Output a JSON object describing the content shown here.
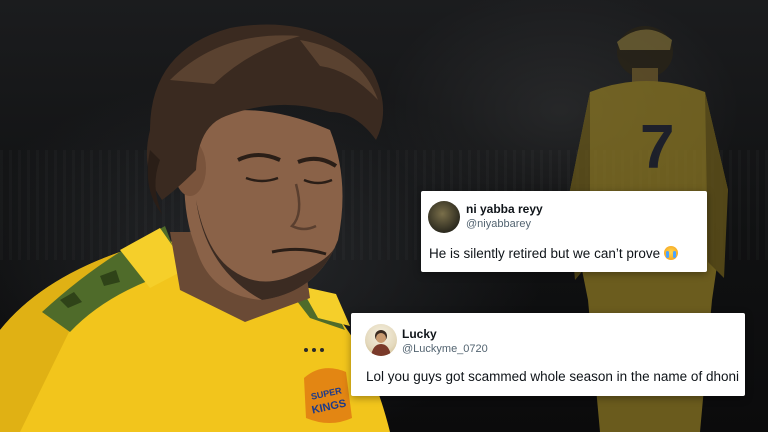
{
  "tweets": [
    {
      "display_name": "ni yabba reyy",
      "handle": "@niyabbarey",
      "text": "He is silently retired but we can’t prove",
      "emoji": "loudly-crying-face-icon"
    },
    {
      "display_name": "Lucky",
      "handle": "@Luckyme_0720",
      "text": "Lol you guys got scammed whole season in the name of dhoni"
    }
  ],
  "jersey": {
    "logo_text": "SUPER KINGS",
    "back_number": "7"
  },
  "colors": {
    "jersey_yellow": "#f2c51c",
    "camo_green": "#4f6b2a",
    "background": "#101112",
    "card": "#ffffff",
    "handle_grey": "#536471"
  }
}
